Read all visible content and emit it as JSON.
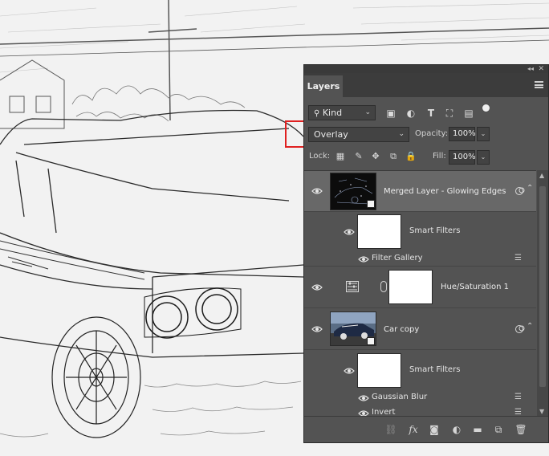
{
  "panel": {
    "collapse_glyph": "◂◂",
    "close_glyph": "✕",
    "tab_label": "Layers",
    "filter": {
      "kind_label": "Kind",
      "icons": [
        "image-filter-icon",
        "adjustment-filter-icon",
        "type-filter-icon",
        "shape-filter-icon",
        "smart-object-filter-icon",
        "filter-toggle-icon"
      ]
    },
    "blend_mode": "Overlay",
    "opacity_label": "Opacity:",
    "opacity_value": "100%",
    "lock_label": "Lock:",
    "fill_label": "Fill:",
    "fill_value": "100%",
    "lock_icons": [
      "lock-transparent-pixels-icon",
      "lock-image-pixels-icon",
      "lock-position-icon",
      "prevent-auto-nesting-icon",
      "lock-all-icon"
    ]
  },
  "layers": [
    {
      "name": "Merged Layer - Glowing Edges",
      "type": "smart-object",
      "selected": true
    },
    {
      "name": "Smart Filters",
      "type": "smart-filters"
    },
    {
      "name": "Filter Gallery",
      "type": "filter"
    },
    {
      "name": "Hue/Saturation 1",
      "type": "adjustment"
    },
    {
      "name": "Car copy",
      "type": "smart-object"
    },
    {
      "name": "Smart Filters",
      "type": "smart-filters"
    },
    {
      "name": "Gaussian Blur",
      "type": "filter"
    },
    {
      "name": "Invert",
      "type": "filter"
    }
  ],
  "bottom_icons": [
    "link-layers-icon",
    "fx-icon",
    "add-mask-icon",
    "new-adjustment-icon",
    "new-group-icon",
    "new-layer-icon",
    "delete-layer-icon"
  ],
  "colors": {
    "highlight": "#e02020",
    "panel_bg": "#535353",
    "selected_row": "#686868"
  }
}
